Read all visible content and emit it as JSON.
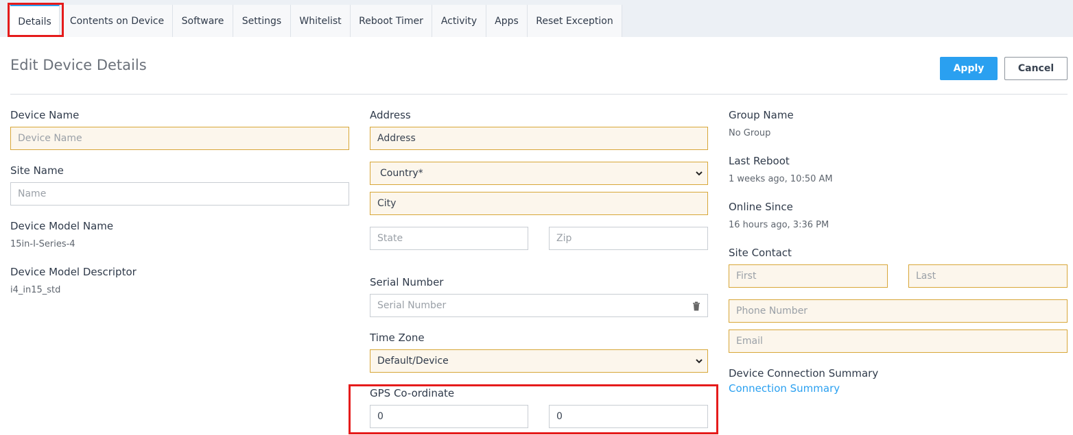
{
  "tabs": [
    {
      "label": "Details"
    },
    {
      "label": "Contents on Device"
    },
    {
      "label": "Software"
    },
    {
      "label": "Settings"
    },
    {
      "label": "Whitelist"
    },
    {
      "label": "Reboot Timer"
    },
    {
      "label": "Activity"
    },
    {
      "label": "Apps"
    },
    {
      "label": "Reset Exception"
    }
  ],
  "header": {
    "title": "Edit Device Details",
    "apply_label": "Apply",
    "cancel_label": "Cancel"
  },
  "left": {
    "device_name_label": "Device Name",
    "device_name_placeholder": "Device Name",
    "site_name_label": "Site Name",
    "site_name_placeholder": "Name",
    "model_name_label": "Device Model Name",
    "model_name_value": "15in-I-Series-4",
    "model_descriptor_label": "Device Model Descriptor",
    "model_descriptor_value": "i4_in15_std"
  },
  "middle": {
    "address_label": "Address",
    "address_value": "Address",
    "country_value": "Country*",
    "city_value": "City",
    "state_placeholder": "State",
    "zip_placeholder": "Zip",
    "serial_label": "Serial Number",
    "serial_placeholder": "Serial Number",
    "timezone_label": "Time Zone",
    "timezone_value": "Default/Device",
    "gps_label": "GPS Co-ordinate",
    "gps_lat": "0",
    "gps_lng": "0"
  },
  "right": {
    "group_label": "Group Name",
    "group_value": "No Group",
    "reboot_label": "Last Reboot",
    "reboot_value": "1 weeks ago, 10:50 AM",
    "online_label": "Online Since",
    "online_value": "16 hours ago, 3:36 PM",
    "contact_label": "Site Contact",
    "first_placeholder": "First",
    "last_placeholder": "Last",
    "phone_placeholder": "Phone Number",
    "email_placeholder": "Email",
    "connection_label": "Device Connection Summary",
    "connection_link": "Connection Summary"
  },
  "colors": {
    "accent": "#2aa0f0",
    "highlight": "#e51b1b",
    "required_bg": "#fcf6ec",
    "required_border": "#d7a637"
  }
}
